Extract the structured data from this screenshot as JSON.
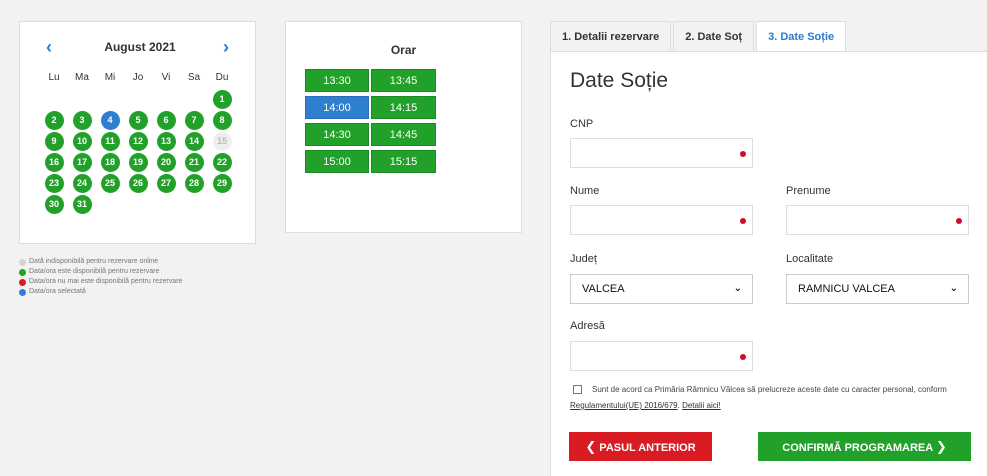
{
  "calendar": {
    "prev_icon": "‹",
    "next_icon": "›",
    "month_title": "August 2021",
    "weekdays": [
      "Lu",
      "Ma",
      "Mi",
      "Jo",
      "Vi",
      "Sa",
      "Du"
    ],
    "days": [
      {
        "n": "1",
        "s": "avail"
      },
      {
        "n": "2",
        "s": "avail"
      },
      {
        "n": "3",
        "s": "avail"
      },
      {
        "n": "4",
        "s": "sel"
      },
      {
        "n": "5",
        "s": "avail"
      },
      {
        "n": "6",
        "s": "avail"
      },
      {
        "n": "7",
        "s": "avail"
      },
      {
        "n": "8",
        "s": "avail"
      },
      {
        "n": "9",
        "s": "avail"
      },
      {
        "n": "10",
        "s": "avail"
      },
      {
        "n": "11",
        "s": "avail"
      },
      {
        "n": "12",
        "s": "avail"
      },
      {
        "n": "13",
        "s": "avail"
      },
      {
        "n": "14",
        "s": "avail"
      },
      {
        "n": "15",
        "s": "unav"
      },
      {
        "n": "16",
        "s": "avail"
      },
      {
        "n": "17",
        "s": "avail"
      },
      {
        "n": "18",
        "s": "avail"
      },
      {
        "n": "19",
        "s": "avail"
      },
      {
        "n": "20",
        "s": "avail"
      },
      {
        "n": "21",
        "s": "avail"
      },
      {
        "n": "22",
        "s": "avail"
      },
      {
        "n": "23",
        "s": "avail"
      },
      {
        "n": "24",
        "s": "avail"
      },
      {
        "n": "25",
        "s": "avail"
      },
      {
        "n": "26",
        "s": "avail"
      },
      {
        "n": "27",
        "s": "avail"
      },
      {
        "n": "28",
        "s": "avail"
      },
      {
        "n": "29",
        "s": "avail"
      },
      {
        "n": "30",
        "s": "avail"
      },
      {
        "n": "31",
        "s": "avail"
      }
    ],
    "legend": [
      {
        "text": "Dată indisponibilă pentru rezervare online",
        "color": "#d4d4d4"
      },
      {
        "text": "Data/ora este disponibilă pentru rezervare",
        "color": "#22a12a"
      },
      {
        "text": "Data/ora nu mai este disponibilă pentru rezervare",
        "color": "#d91c24"
      },
      {
        "text": "Data/ora selectată",
        "color": "#2f7fd1"
      }
    ]
  },
  "orar": {
    "title": "Orar",
    "slots": [
      {
        "t": "13:30",
        "s": "avail"
      },
      {
        "t": "13:45",
        "s": "avail"
      },
      {
        "t": "14:00",
        "s": "sel"
      },
      {
        "t": "14:15",
        "s": "avail"
      },
      {
        "t": "14:30",
        "s": "avail"
      },
      {
        "t": "14:45",
        "s": "avail"
      },
      {
        "t": "15:00",
        "s": "avail"
      },
      {
        "t": "15:15",
        "s": "avail"
      }
    ]
  },
  "tabs": [
    {
      "label": "1. Detalii rezervare",
      "active": false
    },
    {
      "label": "2. Date Soț",
      "active": false
    },
    {
      "label": "3. Date Soție",
      "active": true
    }
  ],
  "form": {
    "title": "Date Soție",
    "cnp_label": "CNP",
    "nume_label": "Nume",
    "prenume_label": "Prenume",
    "judet_label": "Județ",
    "judet_value": "VALCEA",
    "localitate_label": "Localitate",
    "localitate_value": "RAMNICU VALCEA",
    "adresa_label": "Adresă",
    "chevron": "⌄",
    "consent_text": "Sunt de acord ca Primăria Râmnicu Vâlcea să prelucreze aceste date cu caracter personal, conform ",
    "consent_link1": "Regulamentului(UE) 2016/679",
    "consent_sep": ". ",
    "consent_link2": "Detalii aici!",
    "btn_prev_arrow": "❮",
    "btn_prev_label": "PASUL ANTERIOR",
    "btn_next_label": "CONFIRMĂ PROGRAMAREA",
    "btn_next_arrow": "❯"
  },
  "colors": {
    "available": "#22a12a",
    "selected": "#2f7fd1",
    "unavailable": "#d91c24",
    "disabled": "#d4d4d4",
    "accent": "#2b7bd0"
  }
}
